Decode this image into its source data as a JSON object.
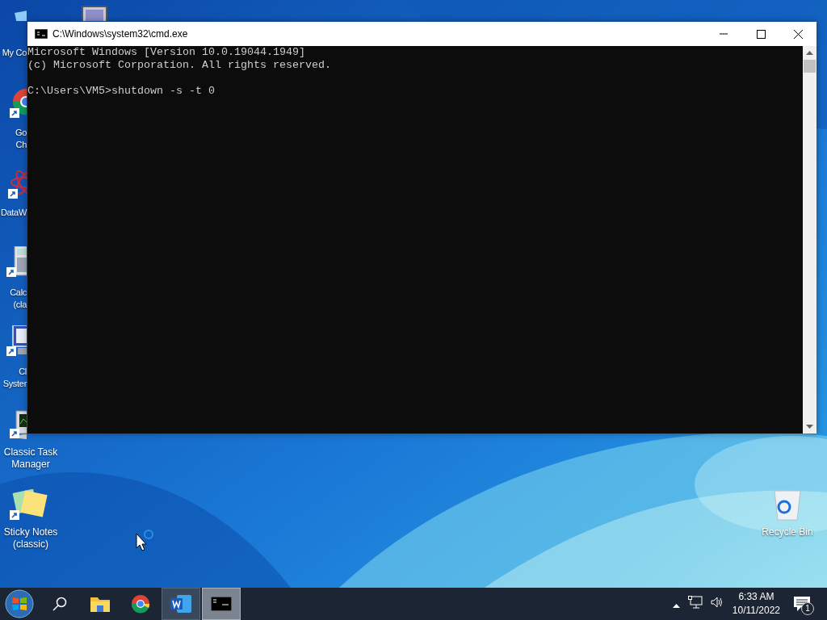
{
  "desktop": {
    "icons": [
      {
        "kind": "computer",
        "lines": [
          "My Co"
        ]
      },
      {
        "kind": "monitor"
      },
      {
        "kind": "chrome",
        "lines": [
          "Go",
          "Ch"
        ]
      },
      {
        "kind": "atom",
        "lines": [
          "DataW"
        ]
      },
      {
        "kind": "calculator",
        "lines": [
          "Calc",
          "(cla"
        ]
      },
      {
        "kind": "system",
        "lines": [
          "Cl",
          "Syster"
        ]
      },
      {
        "kind": "taskmanager",
        "lines": [
          "Classic Task",
          "Manager"
        ]
      },
      {
        "kind": "sticky",
        "lines": [
          "Sticky Notes",
          "(classic)"
        ]
      },
      {
        "kind": "recycle",
        "lines": [
          "Recycle Bin"
        ]
      }
    ]
  },
  "window": {
    "title": "C:\\Windows\\system32\\cmd.exe",
    "output": [
      "Microsoft Windows [Version 10.0.19044.1949]",
      "(c) Microsoft Corporation. All rights reserved."
    ],
    "command_line": "C:\\Users\\VM5>shutdown -s -t 0"
  },
  "taskbar": {
    "buttons": [
      {
        "kind": "start",
        "running": false,
        "selected": false
      },
      {
        "kind": "search",
        "running": false,
        "selected": false
      },
      {
        "kind": "explorer",
        "running": false,
        "selected": false
      },
      {
        "kind": "chrome",
        "running": false,
        "selected": false
      },
      {
        "kind": "word",
        "running": true,
        "selected": false
      },
      {
        "kind": "cmd",
        "running": true,
        "selected": true
      }
    ],
    "clock": {
      "time": "6:33 AM",
      "date": "10/11/2022"
    },
    "notifications": {
      "count": "1"
    }
  }
}
